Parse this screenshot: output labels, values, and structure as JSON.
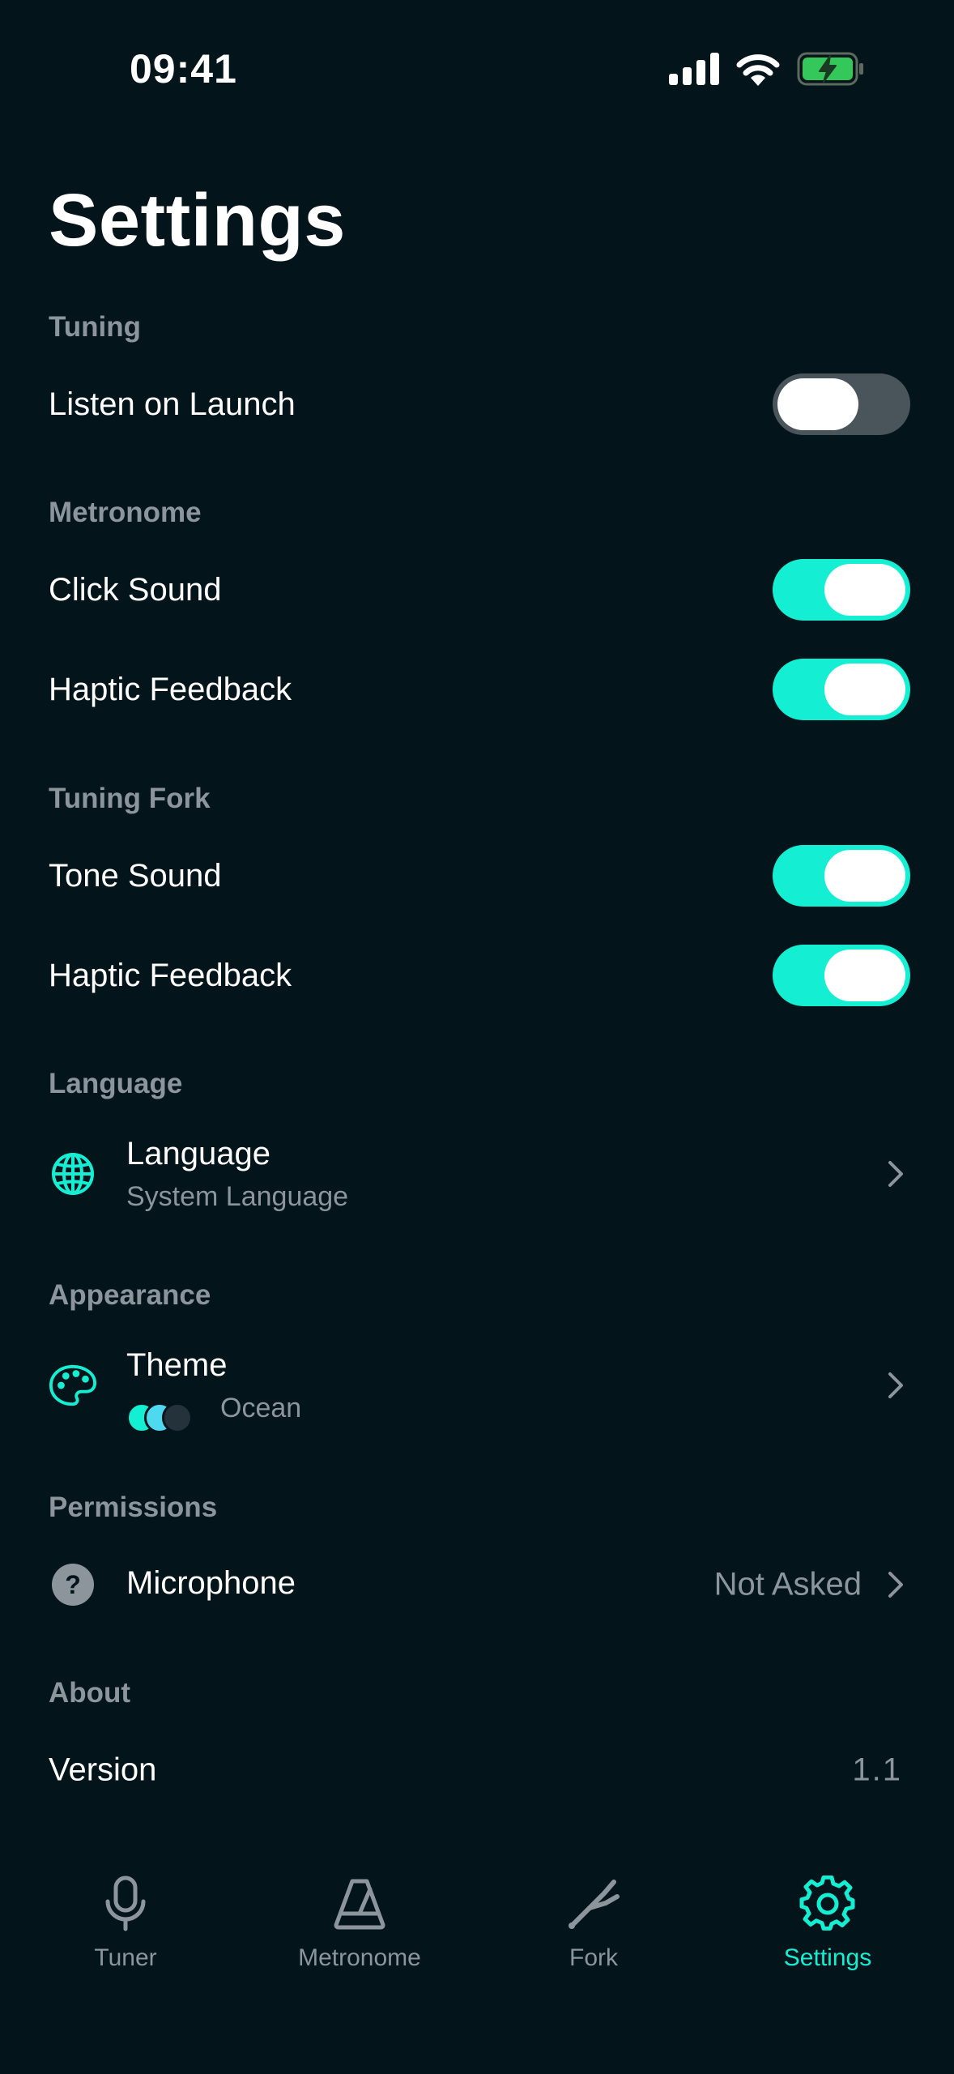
{
  "status_bar": {
    "time": "09:41"
  },
  "page": {
    "title": "Settings"
  },
  "sections": {
    "tuning": {
      "header": "Tuning",
      "listen_on_launch": {
        "label": "Listen on Launch",
        "enabled": false
      }
    },
    "metronome": {
      "header": "Metronome",
      "click_sound": {
        "label": "Click Sound",
        "enabled": true
      },
      "haptic_feedback": {
        "label": "Haptic Feedback",
        "enabled": true
      }
    },
    "tuning_fork": {
      "header": "Tuning Fork",
      "tone_sound": {
        "label": "Tone Sound",
        "enabled": true
      },
      "haptic_feedback": {
        "label": "Haptic Feedback",
        "enabled": true
      }
    },
    "language": {
      "header": "Language",
      "item": {
        "title": "Language",
        "subtitle": "System Language",
        "icon": "globe-icon"
      }
    },
    "appearance": {
      "header": "Appearance",
      "item": {
        "title": "Theme",
        "value": "Ocean",
        "icon": "palette-icon",
        "swatches": [
          "#14EED3",
          "#4FD9F0",
          "#24333B"
        ]
      }
    },
    "permissions": {
      "header": "Permissions",
      "item": {
        "title": "Microphone",
        "value": "Not Asked",
        "icon": "question-circle-icon"
      }
    },
    "about": {
      "header": "About",
      "version": {
        "label": "Version",
        "value": "1.1"
      }
    }
  },
  "tab_bar": {
    "tabs": [
      {
        "label": "Tuner",
        "icon": "microphone-icon",
        "active": false
      },
      {
        "label": "Metronome",
        "icon": "metronome-icon",
        "active": false
      },
      {
        "label": "Fork",
        "icon": "tuning-fork-icon",
        "active": false
      },
      {
        "label": "Settings",
        "icon": "gear-icon",
        "active": true
      }
    ]
  },
  "colors": {
    "background": "#03141B",
    "accent": "#14EED3",
    "secondary_text": "#8B959B",
    "toggle_off": "#4A555B",
    "battery": "#34C759"
  }
}
